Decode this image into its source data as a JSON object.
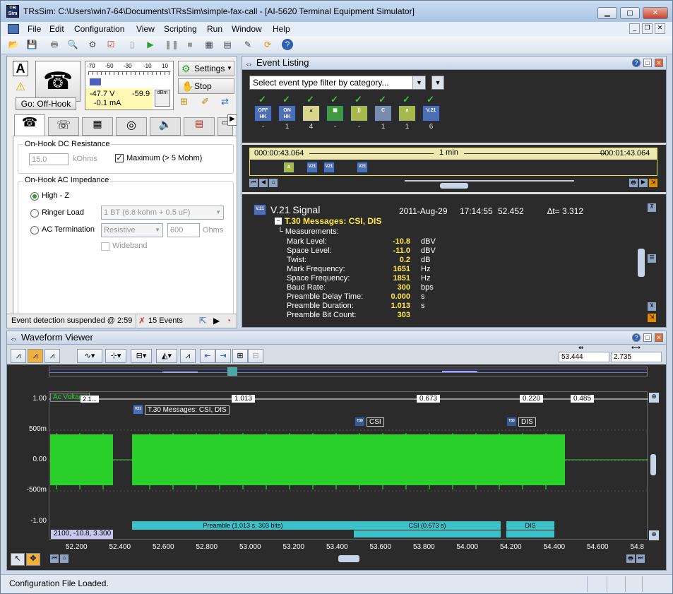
{
  "app": {
    "window_title": "TRsSim:  C:\\Users\\win7-64\\Documents\\TRsSim\\simple-fax-call - [AI-5620  Terminal Equipment Simulator]",
    "icon_text": "TR Sim"
  },
  "menu": [
    "File",
    "Edit",
    "Configuration",
    "View",
    "Scripting",
    "Run",
    "Window",
    "Help"
  ],
  "phone": {
    "label_a": "A",
    "meter_ticks": [
      "-70",
      "-50",
      "-30",
      "-10",
      "10"
    ],
    "voltage": "-47.7  V",
    "current": "-0.1 mA",
    "level": "-59.9",
    "level_unit": "dBm",
    "go_button": "Go:  Off-Hook",
    "settings": "Settings",
    "stop": "Stop"
  },
  "dc_resistance": {
    "title": "On-Hook DC Resistance",
    "value": "15.0",
    "unit": "kOhms",
    "maximum_label": "Maximum (> 5 Mohm)",
    "maximum_checked": true
  },
  "ac_impedance": {
    "title": "On-Hook AC Impedance",
    "high_z": "High - Z",
    "ringer_load": "Ringer Load",
    "ringer_option": "1 BT (6.8 kohm + 0.5 uF)",
    "ac_termination": "AC Termination",
    "term_option": "Resistive",
    "term_value": "600",
    "term_unit": "Ohms",
    "wideband": "Wideband",
    "selected": "High - Z"
  },
  "left_status": {
    "text": "Event detection suspended @ 2:59",
    "events": "15 Events"
  },
  "event_listing": {
    "title": "Event Listing",
    "filter_placeholder": "Select event type filter by category...",
    "categories": [
      {
        "icon": "Off HK",
        "count": "-"
      },
      {
        "icon": "On HK",
        "count": "1"
      },
      {
        "icon": "alert",
        "count": "4"
      },
      {
        "icon": "green",
        "count": "-"
      },
      {
        "icon": "ring",
        "count": "-"
      },
      {
        "icon": "C",
        "count": "1"
      },
      {
        "icon": "a",
        "count": "1"
      },
      {
        "icon": "V.21",
        "count": "6"
      }
    ],
    "timeline": {
      "start": "000:00:43.064",
      "span": "1 min",
      "end": "000:01:43.064"
    }
  },
  "signal": {
    "name": "V.21 Signal",
    "date": "2011-Aug-29",
    "time": "17:14:55",
    "offset": "52.452",
    "delta": "∆t= 3.312",
    "message": "T.30 Messages:  CSI, DIS",
    "measurements_label": "Measurements:",
    "measurements": [
      {
        "label": "Mark Level:",
        "value": "-10.8",
        "unit": "dBV"
      },
      {
        "label": "Space Level:",
        "value": "-11.0",
        "unit": "dBV"
      },
      {
        "label": "Twist:",
        "value": "0.2",
        "unit": "dB"
      },
      {
        "label": "Mark Frequency:",
        "value": "1651",
        "unit": "Hz"
      },
      {
        "label": "Space Frequency:",
        "value": "1851",
        "unit": "Hz"
      },
      {
        "label": "Baud Rate:",
        "value": "300",
        "unit": "bps"
      },
      {
        "label": "Preamble Delay Time:",
        "value": "0.000",
        "unit": "s"
      },
      {
        "label": "Preamble Duration:",
        "value": "1.013",
        "unit": "s"
      },
      {
        "label": "Preamble Bit Count:",
        "value": "303",
        "unit": ""
      }
    ]
  },
  "waveform": {
    "title": "Waveform Viewer",
    "cursor_pos": "53.444",
    "cursor_delta": "2.735",
    "trace_label": "Ac Voltage",
    "y_ticks": [
      "1.00",
      "500m",
      "0.00",
      "-500m",
      "-1.00"
    ],
    "x_ticks": [
      "52.200",
      "52.400",
      "52.600",
      "52.800",
      "53.000",
      "53.200",
      "53.400",
      "53.600",
      "53.800",
      "54.000",
      "54.200",
      "54.400",
      "54.600",
      "54.8"
    ],
    "intervals": [
      "1.013",
      "0.673",
      "0.220",
      "0.485"
    ],
    "interval_first": "2.1...",
    "annotations": {
      "t30": "T.30 Messages:  CSI, DIS",
      "csi": "CSI",
      "dis": "DIS"
    },
    "bars": {
      "preamble": "Preamble (1.013 s, 303 bits)",
      "csi": "CSI (0.673 s)",
      "dis": "DIS"
    },
    "marker": "2100, -10.8, 3.300"
  },
  "status_bar": "Configuration File Loaded.",
  "colors": {
    "wave": "#2bd12b",
    "bar": "#3ec0c8",
    "dark": "#2b2b2b"
  }
}
